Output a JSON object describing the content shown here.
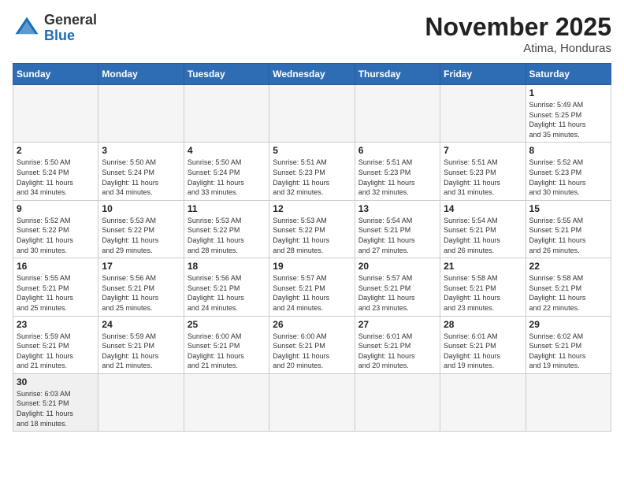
{
  "header": {
    "logo_general": "General",
    "logo_blue": "Blue",
    "month_title": "November 2025",
    "location": "Atima, Honduras"
  },
  "weekdays": [
    "Sunday",
    "Monday",
    "Tuesday",
    "Wednesday",
    "Thursday",
    "Friday",
    "Saturday"
  ],
  "days": [
    {
      "num": "",
      "info": ""
    },
    {
      "num": "",
      "info": ""
    },
    {
      "num": "",
      "info": ""
    },
    {
      "num": "",
      "info": ""
    },
    {
      "num": "",
      "info": ""
    },
    {
      "num": "",
      "info": ""
    },
    {
      "num": "1",
      "info": "Sunrise: 5:49 AM\nSunset: 5:25 PM\nDaylight: 11 hours\nand 35 minutes."
    },
    {
      "num": "2",
      "info": "Sunrise: 5:50 AM\nSunset: 5:24 PM\nDaylight: 11 hours\nand 34 minutes."
    },
    {
      "num": "3",
      "info": "Sunrise: 5:50 AM\nSunset: 5:24 PM\nDaylight: 11 hours\nand 34 minutes."
    },
    {
      "num": "4",
      "info": "Sunrise: 5:50 AM\nSunset: 5:24 PM\nDaylight: 11 hours\nand 33 minutes."
    },
    {
      "num": "5",
      "info": "Sunrise: 5:51 AM\nSunset: 5:23 PM\nDaylight: 11 hours\nand 32 minutes."
    },
    {
      "num": "6",
      "info": "Sunrise: 5:51 AM\nSunset: 5:23 PM\nDaylight: 11 hours\nand 32 minutes."
    },
    {
      "num": "7",
      "info": "Sunrise: 5:51 AM\nSunset: 5:23 PM\nDaylight: 11 hours\nand 31 minutes."
    },
    {
      "num": "8",
      "info": "Sunrise: 5:52 AM\nSunset: 5:23 PM\nDaylight: 11 hours\nand 30 minutes."
    },
    {
      "num": "9",
      "info": "Sunrise: 5:52 AM\nSunset: 5:22 PM\nDaylight: 11 hours\nand 30 minutes."
    },
    {
      "num": "10",
      "info": "Sunrise: 5:53 AM\nSunset: 5:22 PM\nDaylight: 11 hours\nand 29 minutes."
    },
    {
      "num": "11",
      "info": "Sunrise: 5:53 AM\nSunset: 5:22 PM\nDaylight: 11 hours\nand 28 minutes."
    },
    {
      "num": "12",
      "info": "Sunrise: 5:53 AM\nSunset: 5:22 PM\nDaylight: 11 hours\nand 28 minutes."
    },
    {
      "num": "13",
      "info": "Sunrise: 5:54 AM\nSunset: 5:21 PM\nDaylight: 11 hours\nand 27 minutes."
    },
    {
      "num": "14",
      "info": "Sunrise: 5:54 AM\nSunset: 5:21 PM\nDaylight: 11 hours\nand 26 minutes."
    },
    {
      "num": "15",
      "info": "Sunrise: 5:55 AM\nSunset: 5:21 PM\nDaylight: 11 hours\nand 26 minutes."
    },
    {
      "num": "16",
      "info": "Sunrise: 5:55 AM\nSunset: 5:21 PM\nDaylight: 11 hours\nand 25 minutes."
    },
    {
      "num": "17",
      "info": "Sunrise: 5:56 AM\nSunset: 5:21 PM\nDaylight: 11 hours\nand 25 minutes."
    },
    {
      "num": "18",
      "info": "Sunrise: 5:56 AM\nSunset: 5:21 PM\nDaylight: 11 hours\nand 24 minutes."
    },
    {
      "num": "19",
      "info": "Sunrise: 5:57 AM\nSunset: 5:21 PM\nDaylight: 11 hours\nand 24 minutes."
    },
    {
      "num": "20",
      "info": "Sunrise: 5:57 AM\nSunset: 5:21 PM\nDaylight: 11 hours\nand 23 minutes."
    },
    {
      "num": "21",
      "info": "Sunrise: 5:58 AM\nSunset: 5:21 PM\nDaylight: 11 hours\nand 23 minutes."
    },
    {
      "num": "22",
      "info": "Sunrise: 5:58 AM\nSunset: 5:21 PM\nDaylight: 11 hours\nand 22 minutes."
    },
    {
      "num": "23",
      "info": "Sunrise: 5:59 AM\nSunset: 5:21 PM\nDaylight: 11 hours\nand 21 minutes."
    },
    {
      "num": "24",
      "info": "Sunrise: 5:59 AM\nSunset: 5:21 PM\nDaylight: 11 hours\nand 21 minutes."
    },
    {
      "num": "25",
      "info": "Sunrise: 6:00 AM\nSunset: 5:21 PM\nDaylight: 11 hours\nand 21 minutes."
    },
    {
      "num": "26",
      "info": "Sunrise: 6:00 AM\nSunset: 5:21 PM\nDaylight: 11 hours\nand 20 minutes."
    },
    {
      "num": "27",
      "info": "Sunrise: 6:01 AM\nSunset: 5:21 PM\nDaylight: 11 hours\nand 20 minutes."
    },
    {
      "num": "28",
      "info": "Sunrise: 6:01 AM\nSunset: 5:21 PM\nDaylight: 11 hours\nand 19 minutes."
    },
    {
      "num": "29",
      "info": "Sunrise: 6:02 AM\nSunset: 5:21 PM\nDaylight: 11 hours\nand 19 minutes."
    },
    {
      "num": "30",
      "info": "Sunrise: 6:03 AM\nSunset: 5:21 PM\nDaylight: 11 hours\nand 18 minutes."
    },
    {
      "num": "",
      "info": ""
    },
    {
      "num": "",
      "info": ""
    },
    {
      "num": "",
      "info": ""
    },
    {
      "num": "",
      "info": ""
    },
    {
      "num": "",
      "info": ""
    },
    {
      "num": "",
      "info": ""
    }
  ]
}
